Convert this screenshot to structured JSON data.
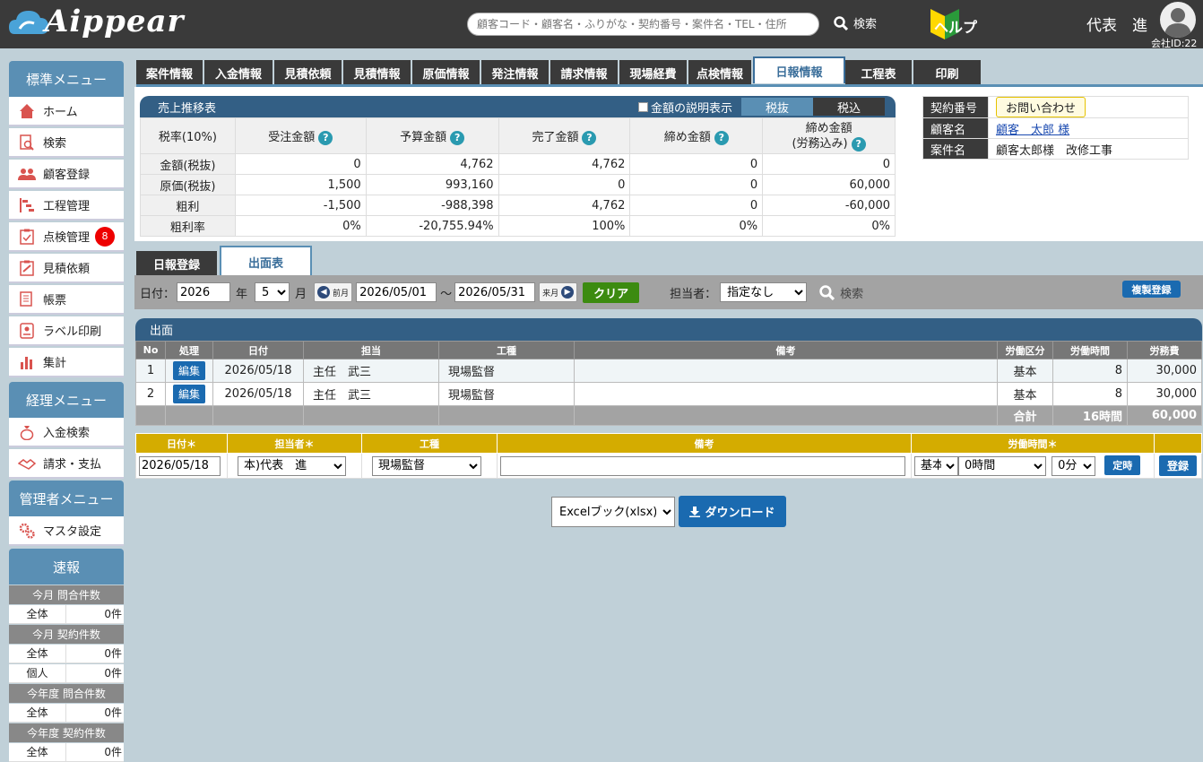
{
  "header": {
    "logo_text": "Aippear",
    "search_placeholder": "顧客コード・顧客名・ふりがな・契約番号・案件名・TEL・住所",
    "search_label": "検索",
    "help_label": "ヘルプ",
    "user_name": "代表　進",
    "company_id": "会社ID:22"
  },
  "sidebar": {
    "standard_title": "標準メニュー",
    "standard_items": [
      {
        "label": "ホーム",
        "icon": "home-icon"
      },
      {
        "label": "検索",
        "icon": "search-doc-icon"
      },
      {
        "label": "顧客登録",
        "icon": "users-icon"
      },
      {
        "label": "工程管理",
        "icon": "gantt-icon"
      },
      {
        "label": "点検管理",
        "icon": "clipboard-icon",
        "badge": "8"
      },
      {
        "label": "見積依頼",
        "icon": "clipboard-edit-icon"
      },
      {
        "label": "帳票",
        "icon": "document-icon"
      },
      {
        "label": "ラベル印刷",
        "icon": "label-icon"
      },
      {
        "label": "集計",
        "icon": "chart-icon"
      }
    ],
    "accounting_title": "経理メニュー",
    "accounting_items": [
      {
        "label": "入金検索",
        "icon": "money-bag-icon"
      },
      {
        "label": "請求・支払",
        "icon": "handshake-icon"
      }
    ],
    "admin_title": "管理者メニュー",
    "admin_items": [
      {
        "label": "マスタ設定",
        "icon": "gears-icon"
      }
    ],
    "flash_title": "速報",
    "stats": [
      {
        "head": "今月 問合件数",
        "rows": [
          {
            "label": "全体",
            "value": "0件"
          }
        ]
      },
      {
        "head": "今月 契約件数",
        "rows": [
          {
            "label": "全体",
            "value": "0件"
          },
          {
            "label": "個人",
            "value": "0件"
          }
        ]
      },
      {
        "head": "今年度 問合件数",
        "rows": [
          {
            "label": "全体",
            "value": "0件"
          }
        ]
      },
      {
        "head": "今年度 契約件数",
        "rows": [
          {
            "label": "全体",
            "value": "0件"
          }
        ]
      }
    ]
  },
  "tabs": [
    {
      "label": "案件情報"
    },
    {
      "label": "入金情報"
    },
    {
      "label": "見積依頼"
    },
    {
      "label": "見積情報"
    },
    {
      "label": "原価情報"
    },
    {
      "label": "発注情報"
    },
    {
      "label": "請求情報"
    },
    {
      "label": "現場経費"
    },
    {
      "label": "点検情報"
    },
    {
      "label": "日報情報",
      "active": true
    },
    {
      "label": "工程表"
    },
    {
      "label": "印刷"
    }
  ],
  "sales": {
    "title": "売上推移表",
    "checkbox_label": "金額の説明表示",
    "tax_excl": "税抜",
    "tax_incl": "税込",
    "headers": [
      "税率(10%)",
      "受注金額",
      "予算金額",
      "完了金額",
      "締め金額",
      "締め金額",
      "(労務込み)"
    ],
    "rows": [
      {
        "label": "金額(税抜)",
        "values": [
          "0",
          "4,762",
          "4,762",
          "0",
          "0"
        ]
      },
      {
        "label": "原価(税抜)",
        "values": [
          "1,500",
          "993,160",
          "0",
          "0",
          "60,000"
        ]
      },
      {
        "label": "粗利",
        "values": [
          "-1,500",
          "-988,398",
          "4,762",
          "0",
          "-60,000"
        ]
      },
      {
        "label": "粗利率",
        "values": [
          "0%",
          "-20,755.94%",
          "100%",
          "0%",
          "0%"
        ]
      }
    ]
  },
  "contract": {
    "number_label": "契約番号",
    "inquiry_button": "お問い合わせ",
    "customer_label": "顧客名",
    "customer_value": "顧客　太郎 様",
    "project_label": "案件名",
    "project_value": "顧客太郎様　改修工事"
  },
  "subtabs": {
    "daily": "日報登録",
    "attendance": "出面表"
  },
  "filter": {
    "date_label": "日付：",
    "year": "2026",
    "year_unit": "年",
    "month": "5",
    "month_unit": "月",
    "prev_label": "前月",
    "from": "2026/05/01",
    "tilde": "～",
    "to": "2026/05/31",
    "next_label": "来月",
    "clear": "クリア",
    "staff_label": "担当者：",
    "staff_value": "指定なし",
    "search": "検索",
    "copy_register": "複製登録"
  },
  "attendance": {
    "title": "出面",
    "columns": [
      "No",
      "処理",
      "日付",
      "担当",
      "工種",
      "備考",
      "労働区分",
      "労働時間",
      "労務費"
    ],
    "rows": [
      {
        "no": "1",
        "edit": "編集",
        "date": "2026/05/18",
        "staff": "主任　武三",
        "work": "現場監督",
        "note": "",
        "category": "基本",
        "hours": "8",
        "cost": "30,000"
      },
      {
        "no": "2",
        "edit": "編集",
        "date": "2026/05/18",
        "staff": "主任　武三",
        "work": "現場監督",
        "note": "",
        "category": "基本",
        "hours": "8",
        "cost": "30,000"
      }
    ],
    "total_label": "合計",
    "total_hours": "16時間",
    "total_cost": "60,000"
  },
  "entry": {
    "columns": [
      "日付＊",
      "担当者＊",
      "工種",
      "備考",
      "労働時間＊"
    ],
    "date": "2026/05/18",
    "staff": "本)代表　進",
    "work": "現場監督",
    "category": "基本",
    "hours": "0時間",
    "minutes": "0分",
    "fixed_time": "定時",
    "register": "登録"
  },
  "export": {
    "format": "Excelブック(xlsx)",
    "download": "ダウンロード"
  },
  "colors": {
    "header_bg": "#3a3a3a",
    "accent_blue": "#335f85",
    "button_blue": "#1a6ab0",
    "gold": "#d4ac00",
    "green": "#3c8b10",
    "badge_red": "#e00000"
  }
}
